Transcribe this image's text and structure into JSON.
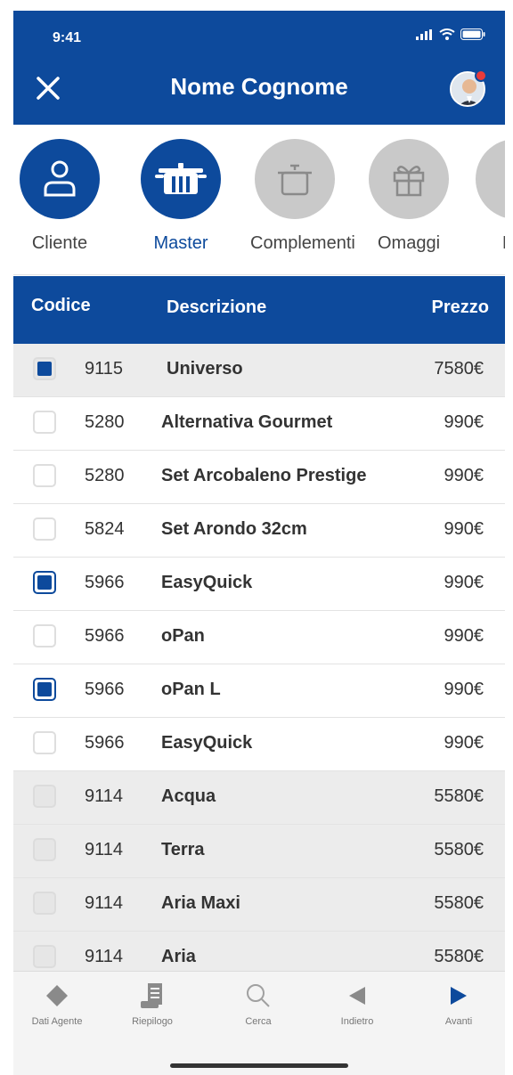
{
  "status": {
    "time": "9:41"
  },
  "header": {
    "title": "Nome Cognome"
  },
  "categories": [
    {
      "label": "Cliente",
      "icon": "person-icon",
      "active": true
    },
    {
      "label": "Master",
      "icon": "pot-set-icon",
      "active": true
    },
    {
      "label": "Complementi",
      "icon": "pot-icon",
      "active": false
    },
    {
      "label": "Omaggi",
      "icon": "gift-icon",
      "active": false
    },
    {
      "label": "Rie",
      "icon": "more-icon",
      "active": false
    }
  ],
  "table": {
    "headers": {
      "code": "Codice",
      "description": "Descrizione",
      "price": "Prezzo"
    },
    "rows": [
      {
        "code": "9115",
        "description": "Universo",
        "price": "7580€",
        "checked": true
      },
      {
        "code": "5280",
        "description": "Alternativa Gourmet",
        "price": "990€",
        "checked": false
      },
      {
        "code": "5280",
        "description": "Set Arcobaleno Prestige",
        "price": "990€",
        "checked": false
      },
      {
        "code": "5824",
        "description": "Set Arondo 32cm",
        "price": "990€",
        "checked": false
      },
      {
        "code": "5966",
        "description": "EasyQuick",
        "price": "990€",
        "checked": true
      },
      {
        "code": "5966",
        "description": "oPan",
        "price": "990€",
        "checked": false
      },
      {
        "code": "5966",
        "description": "oPan L",
        "price": "990€",
        "checked": true
      },
      {
        "code": "5966",
        "description": "EasyQuick",
        "price": "990€",
        "checked": false
      },
      {
        "code": "9114",
        "description": "Acqua",
        "price": "5580€",
        "checked": false
      },
      {
        "code": "9114",
        "description": "Terra",
        "price": "5580€",
        "checked": false
      },
      {
        "code": "9114",
        "description": "Aria Maxi",
        "price": "5580€",
        "checked": false
      },
      {
        "code": "9114",
        "description": "Aria",
        "price": "5580€",
        "checked": false
      }
    ]
  },
  "tabbar": [
    {
      "label": "Dati Agente",
      "icon": "diamond-icon"
    },
    {
      "label": "Riepilogo",
      "icon": "receipt-icon"
    },
    {
      "label": "Cerca",
      "icon": "search-icon"
    },
    {
      "label": "Indietro",
      "icon": "back-arrow-icon"
    },
    {
      "label": "Avanti",
      "icon": "forward-arrow-icon"
    }
  ],
  "colors": {
    "primary": "#0d4a9c",
    "inactive": "#c9c9c9"
  }
}
